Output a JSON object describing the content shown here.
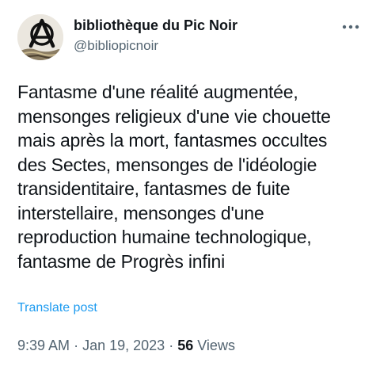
{
  "author": {
    "display_name": "bibliothèque du Pic Noir",
    "handle": "@bibliopicnoir"
  },
  "post": {
    "text_lines": [
      "Fantasme d'une réalité augmentée,",
      "mensonges religieux d'une vie chouette",
      "mais après la mort, fantasmes occultes",
      "des Sectes, mensonges de l'idéologie",
      "transidentitaire, fantasmes de fuite",
      "interstellaire, mensonges d'une",
      "reproduction humaine technologique,",
      "fantasme de Progrès infini"
    ],
    "translate_label": "Translate post"
  },
  "meta": {
    "time": "9:39 AM",
    "separator": "·",
    "date": "Jan 19, 2023",
    "views_count": "56",
    "views_label": "Views"
  },
  "icons": {
    "avatar": "anarchy-symbol-logo",
    "more": "more-horizontal-icon"
  },
  "colors": {
    "text": "#0f1419",
    "secondary": "#536471",
    "link": "#1d9bf0"
  }
}
